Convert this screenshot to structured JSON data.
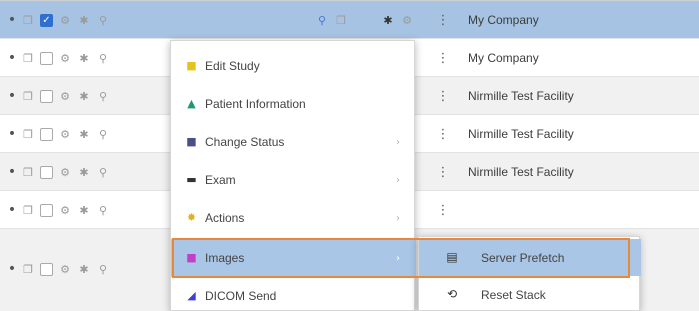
{
  "rows": [
    {
      "facility": "My Company",
      "selected": true
    },
    {
      "facility": "My Company",
      "selected": false
    },
    {
      "facility": "Nirmille Test Facility",
      "selected": false
    },
    {
      "facility": "Nirmille Test Facility",
      "selected": false
    },
    {
      "facility": "Nirmille Test Facility",
      "selected": false
    },
    {
      "facility": "",
      "selected": false
    },
    {
      "facility": "",
      "selected": false
    }
  ],
  "row_icons": {
    "bullet": "•",
    "copy": "❐",
    "checked": "✓",
    "gear": "⚙",
    "star": "✱",
    "link": "⚲",
    "kebab": "⋮"
  },
  "context_menu": {
    "items": [
      {
        "label": "Edit Study",
        "icon": "edit-icon",
        "glyph": "■",
        "color": "#e6c21f",
        "has_submenu": false
      },
      {
        "label": "Patient Information",
        "icon": "person-icon",
        "glyph": "▲",
        "color": "#1f9a6e",
        "has_submenu": false
      },
      {
        "label": "Change Status",
        "icon": "status-icon",
        "glyph": "■",
        "color": "#4a4f8c",
        "has_submenu": true
      },
      {
        "label": "Exam",
        "icon": "folder-icon",
        "glyph": "▬",
        "color": "#333333",
        "has_submenu": true
      },
      {
        "label": "Actions",
        "icon": "star-icon",
        "glyph": "✸",
        "color": "#e0b21a",
        "has_submenu": true
      },
      {
        "label": "Images",
        "icon": "image-icon",
        "glyph": "■",
        "color": "#c23fc9",
        "has_submenu": true,
        "active": true
      },
      {
        "label": "DICOM Send",
        "icon": "send-icon",
        "glyph": "◢",
        "color": "#3d3fd6",
        "has_submenu": false
      }
    ],
    "submenu_arrow": "›"
  },
  "images_submenu": {
    "items": [
      {
        "label": "Server Prefetch",
        "icon": "server-icon",
        "glyph": "▤",
        "active": true
      },
      {
        "label": "Reset Stack",
        "icon": "refresh-icon",
        "glyph": "⟲",
        "active": false
      }
    ]
  },
  "colors": {
    "selected_row": "#a6c3e3",
    "menu_highlight": "#a9c6e6",
    "focus_outline": "#e8893a"
  }
}
